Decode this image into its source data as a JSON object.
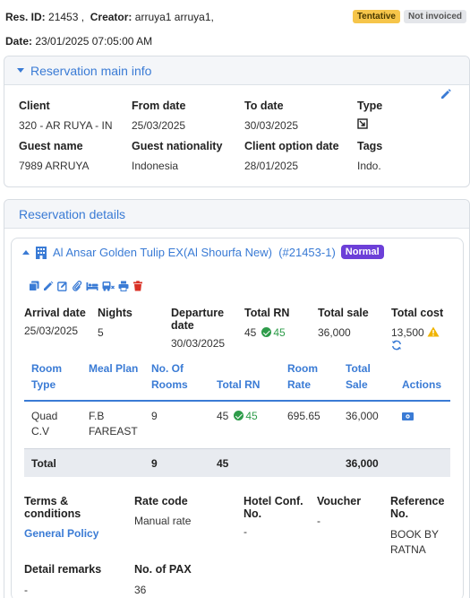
{
  "header": {
    "res_id_label": "Res. ID:",
    "res_id": "21453 ,",
    "creator_label": "Creator:",
    "creator": "arruya1 arruya1,",
    "date_label": "Date:",
    "date": "23/01/2025 07:05:00 AM",
    "status_badge": "Tentative",
    "invoice_badge": "Not invoiced"
  },
  "main_info": {
    "title": "Reservation main info",
    "fields": [
      {
        "label": "Client",
        "value": "320 - AR RUYA - IN"
      },
      {
        "label": "From date",
        "value": "25/03/2025"
      },
      {
        "label": "To date",
        "value": "30/03/2025"
      },
      {
        "label": "Type",
        "value": ""
      },
      {
        "label": "Guest name",
        "value": "7989 ARRUYA"
      },
      {
        "label": "Guest nationality",
        "value": "Indonesia"
      },
      {
        "label": "Client option date",
        "value": "28/01/2025"
      },
      {
        "label": "Tags",
        "value": "Indo."
      }
    ]
  },
  "details": {
    "title": "Reservation details",
    "hotel": {
      "name": "Al Ansar Golden Tulip EX(Al Shourfa New)",
      "code": "(#21453-1)",
      "badge": "Normal"
    },
    "toolbar_icons": [
      "copy-icon",
      "pencil-icon",
      "edit-square-icon",
      "attach-icon",
      "bed-icon",
      "bus-icon",
      "print-icon",
      "delete-icon"
    ],
    "summary": {
      "arrival_label": "Arrival date",
      "arrival": "25/03/2025",
      "nights_label": "Nights",
      "nights": "5",
      "departure_label": "Departure date",
      "departure": "30/03/2025",
      "total_rn_label": "Total RN",
      "total_rn": "45",
      "total_rn_confirmed": "45",
      "total_sale_label": "Total sale",
      "total_sale": "36,000",
      "total_cost_label": "Total cost",
      "total_cost": "13,500"
    },
    "table": {
      "headers": [
        "Room Type",
        "Meal Plan",
        "No. Of Rooms",
        "Total RN",
        "Room Rate",
        "Total Sale",
        "Actions"
      ],
      "rows": [
        {
          "room_type": "Quad C.V",
          "meal_plan": "F.B FAREAST",
          "rooms": "9",
          "total_rn": "45",
          "rn_confirmed": "45",
          "rate": "695.65",
          "total_sale": "36,000"
        }
      ],
      "total": {
        "label": "Total",
        "rooms": "9",
        "total_rn": "45",
        "total_sale": "36,000"
      }
    },
    "extra": {
      "terms_label": "Terms & conditions",
      "terms_link": "General Policy",
      "rate_code_label": "Rate code",
      "rate_code": "Manual rate",
      "hotel_conf_label": "Hotel Conf. No.",
      "hotel_conf": "-",
      "voucher_label": "Voucher",
      "voucher": "-",
      "reference_label": "Reference No.",
      "reference": "BOOK BY RATNA",
      "remarks_label": "Detail remarks",
      "remarks": "-",
      "pax_label": "No. of PAX",
      "pax": "36"
    }
  },
  "colors": {
    "accent": "#3a7bd5",
    "tentative": "#f6c54a",
    "normal_badge": "#6c3fd8",
    "success": "#2e9c4a",
    "warning": "#f0b400",
    "danger": "#d93025"
  }
}
